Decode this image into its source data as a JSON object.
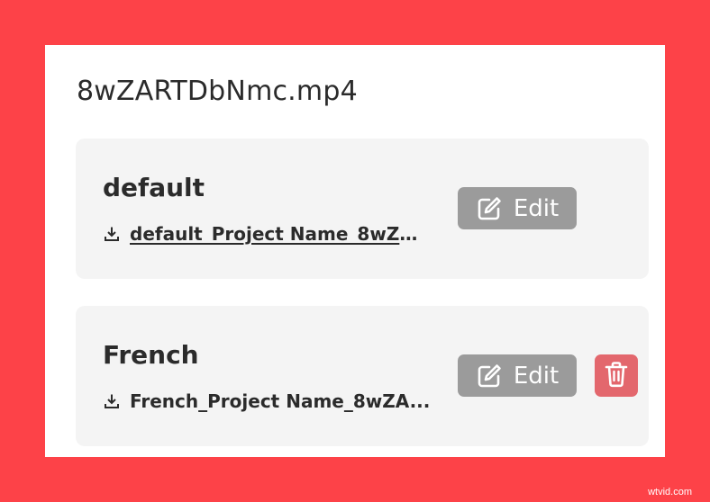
{
  "file": {
    "title": "8wZARTDbNmc.mp4"
  },
  "tracks": [
    {
      "name": "default",
      "download_label": "default_Project Name_8wZA...",
      "download_icon": "download-icon",
      "edit_label": "Edit",
      "edit_icon": "edit-icon"
    },
    {
      "name": "French",
      "download_label": "French_Project Name_8wZA...",
      "download_icon": "download-icon",
      "edit_label": "Edit",
      "edit_icon": "edit-icon",
      "delete_icon": "trash-icon"
    }
  ],
  "watermark": "wtvid.com",
  "colors": {
    "background": "#fd4248",
    "edit_button": "#9b9b9b",
    "delete_button": "#e3676d",
    "card": "#f4f4f4"
  }
}
